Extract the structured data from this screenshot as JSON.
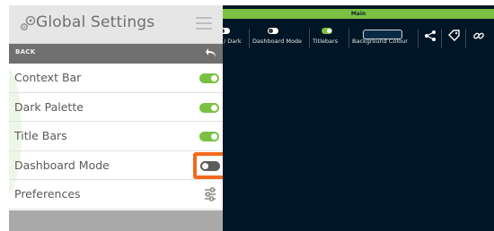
{
  "panel": {
    "title": "Global Settings",
    "back_label": "BACK",
    "rows": [
      {
        "label": "Context Bar",
        "state": "on"
      },
      {
        "label": "Dark Palette",
        "state": "on"
      },
      {
        "label": "Title Bars",
        "state": "on"
      },
      {
        "label": "Dashboard Mode",
        "state": "off"
      },
      {
        "label": "Preferences"
      }
    ]
  },
  "dashboard": {
    "title": "Main",
    "toolbar": {
      "dark_label": "/ Dark",
      "dashboard_mode_label": "Dashboard Mode",
      "titlebars_label": "Titlebars",
      "background_colour_label": "Background Colour"
    }
  },
  "colors": {
    "accent": "#7ac143",
    "highlight": "#f36a1c",
    "dashboard_bg": "#001525",
    "header_bg": "#e6e6e6",
    "back_bar_bg": "#707070",
    "footer_bg": "#a9a9a9"
  },
  "icons": {
    "header": "gears-icon",
    "menu": "hamburger-icon",
    "back": "back-arrow-icon",
    "preferences": "sliders-icon",
    "share": "share-icon",
    "tag": "tag-icon",
    "link": "link-icon"
  }
}
